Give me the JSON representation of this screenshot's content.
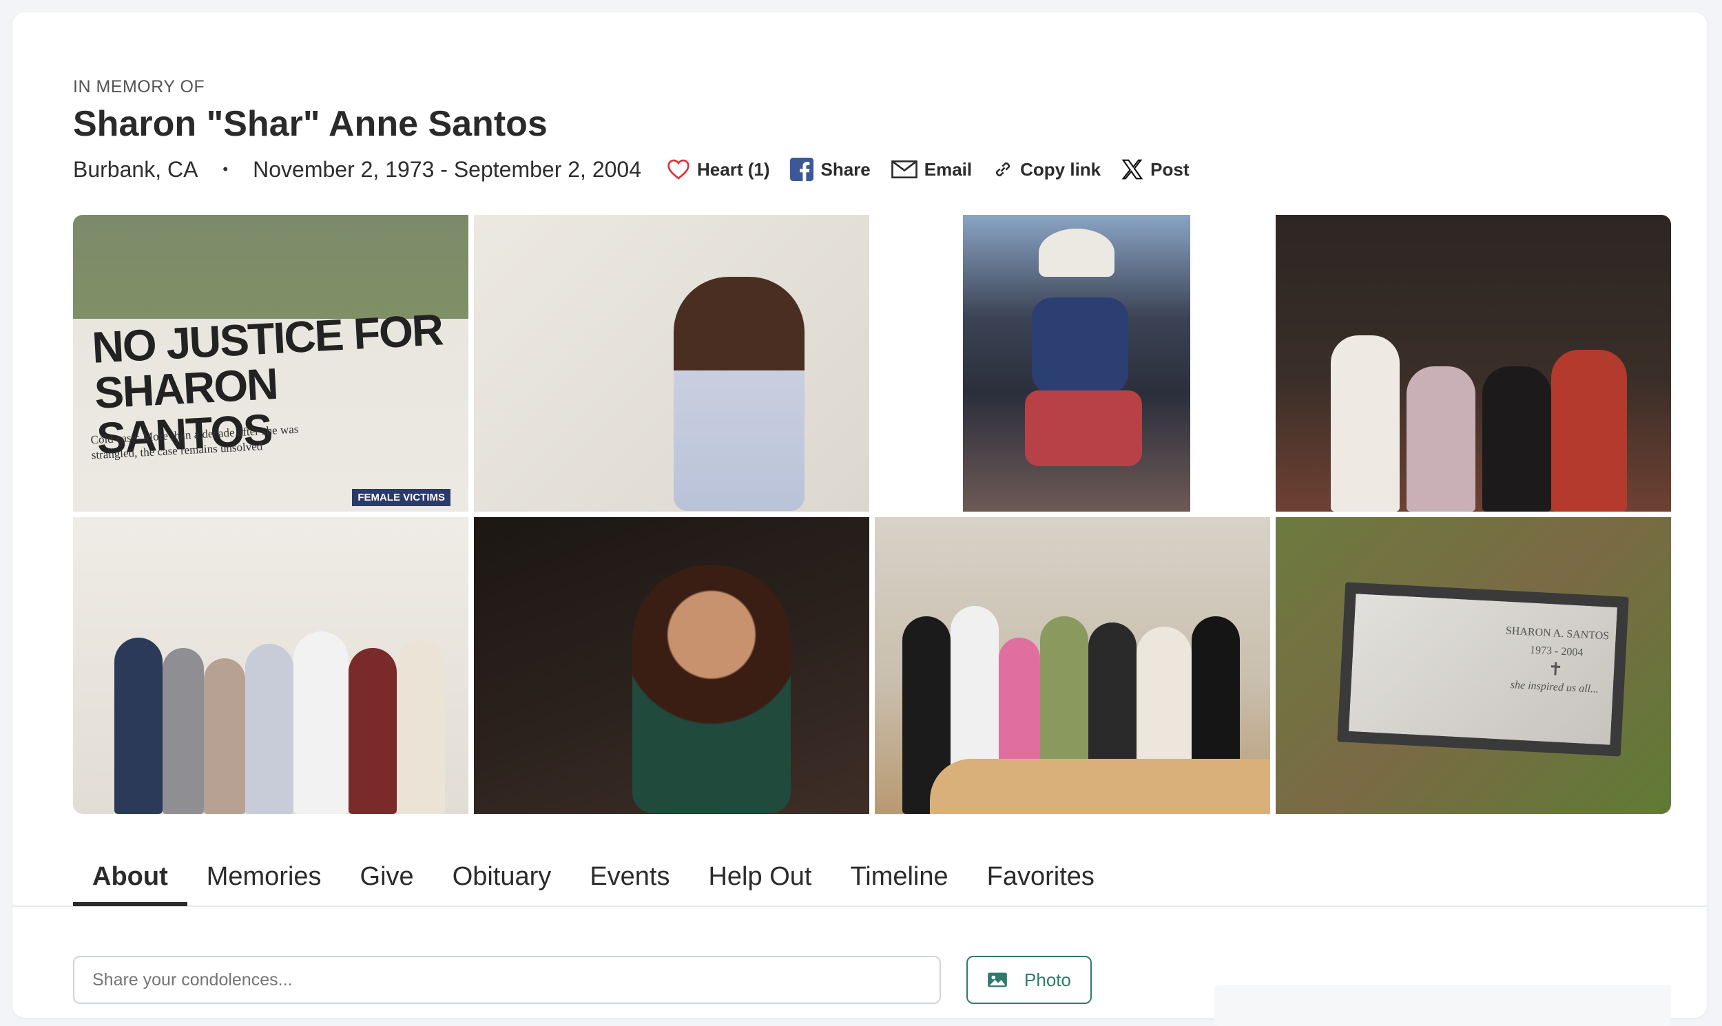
{
  "header": {
    "eyebrow": "IN MEMORY OF",
    "name": "Sharon \"Shar\" Anne Santos",
    "location": "Burbank, CA",
    "separator": "•",
    "dates": "November 2, 1973 - September 2, 2004"
  },
  "actions": {
    "heart_label": "Heart (1)",
    "share_label": "Share",
    "email_label": "Email",
    "copy_link_label": "Copy link",
    "post_label": "Post"
  },
  "gallery": {
    "newspaper": {
      "headline": "NO JUSTICE FOR SHARON SANTOS",
      "subtext": "Cold case: More than a decade after she was strangled, the case remains unsolved",
      "tag": "FEMALE VICTIMS"
    },
    "grave": {
      "name": "SHARON A. SANTOS",
      "years": "1973 - 2004",
      "epitaph": "she inspired us all..."
    }
  },
  "tabs": [
    {
      "label": "About",
      "active": true
    },
    {
      "label": "Memories"
    },
    {
      "label": "Give"
    },
    {
      "label": "Obituary"
    },
    {
      "label": "Events"
    },
    {
      "label": "Help Out"
    },
    {
      "label": "Timeline"
    },
    {
      "label": "Favorites"
    }
  ],
  "condolence": {
    "placeholder": "Share your condolences..."
  },
  "photo_button": {
    "label": "Photo"
  },
  "colors": {
    "accent": "#2f7a6b",
    "heart": "#d9343a",
    "facebook": "#3b5998"
  }
}
